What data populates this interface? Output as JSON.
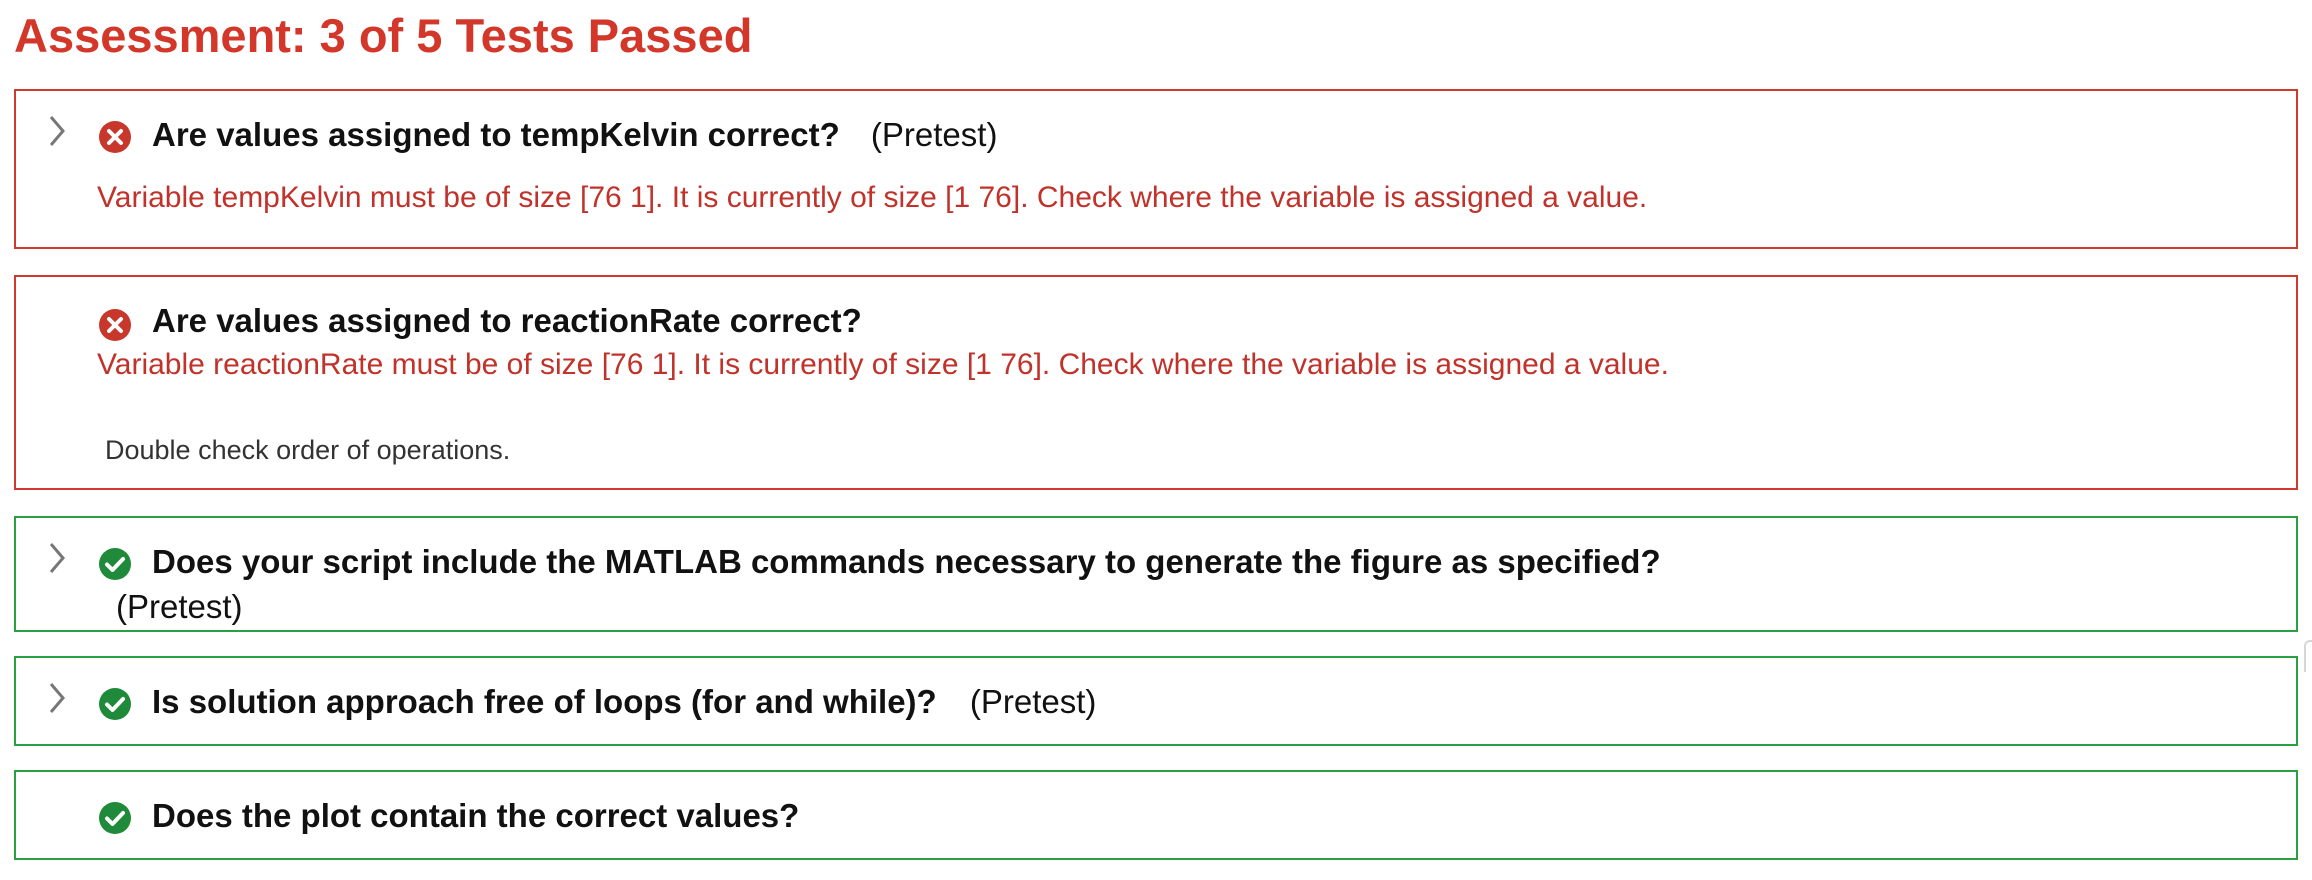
{
  "assessment": {
    "title": "Assessment: 3 of 5 Tests Passed"
  },
  "tests": [
    {
      "status": "fail",
      "title": "Are values assigned to tempKelvin correct?",
      "tag": "(Pretest)",
      "message": "Variable tempKelvin must be of size [76 1]. It is currently of size [1 76]. Check where the variable is assigned a value."
    },
    {
      "status": "fail",
      "title": "Are values assigned to reactionRate correct?",
      "message": "Variable reactionRate must be of size [76 1]. It is currently of size [1 76]. Check where the variable is assigned a value.",
      "hint": "Double check order of operations."
    },
    {
      "status": "pass",
      "title": "Does your script include the MATLAB commands necessary to generate the figure as specified?",
      "tag": "(Pretest)"
    },
    {
      "status": "pass",
      "title": "Is solution approach free of loops (for and while)?",
      "tag": "(Pretest)"
    },
    {
      "status": "pass",
      "title": "Does the plot contain the correct values?"
    }
  ],
  "icons": {
    "fail": "x-circle-icon",
    "pass": "check-circle-icon",
    "expand": "chevron-right-icon"
  },
  "colors": {
    "fail": "#d0392e",
    "pass": "#2aa141",
    "fail_icon": "#c8372c",
    "pass_icon": "#1e8a3a"
  }
}
